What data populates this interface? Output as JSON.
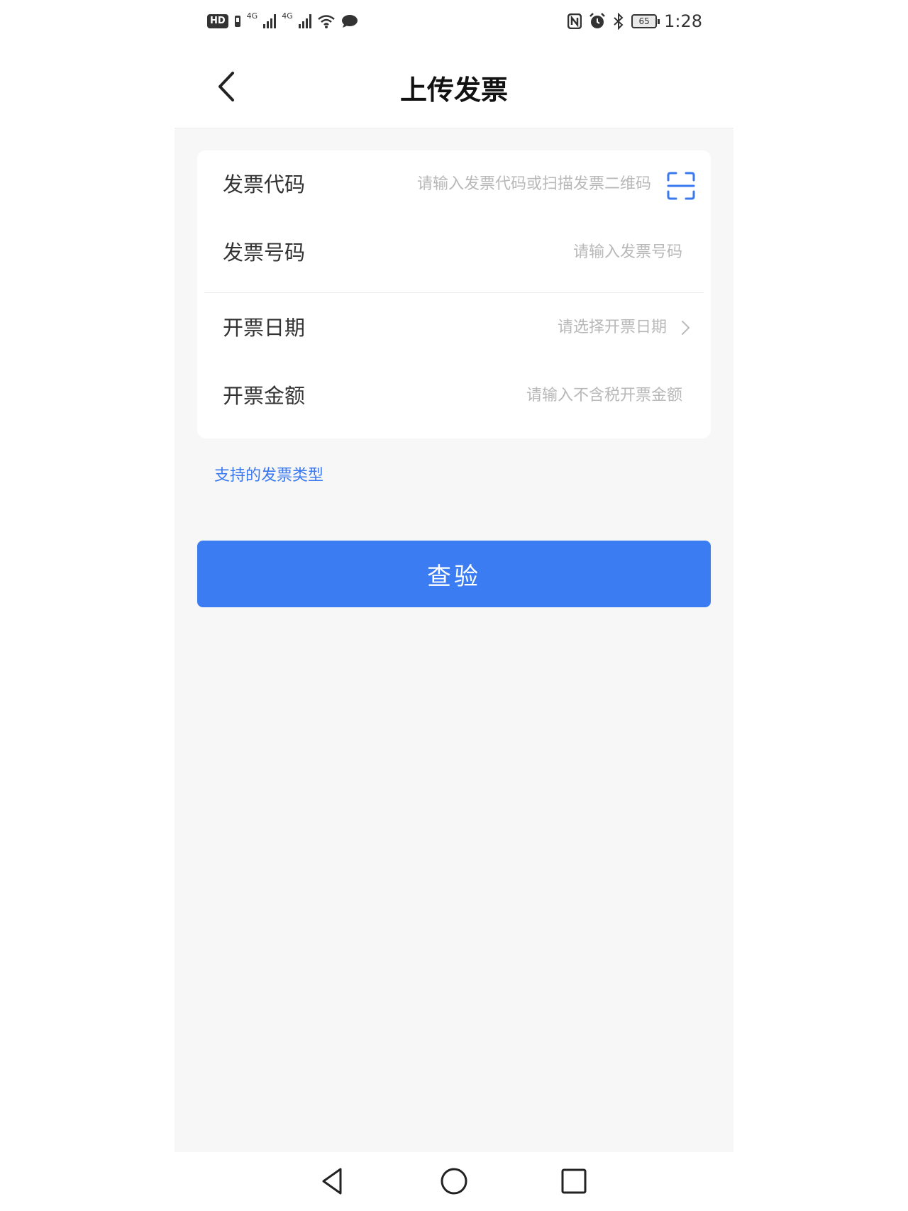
{
  "status_bar": {
    "hd_label": "HD",
    "net1": "4G",
    "net2": "4G",
    "battery": "65",
    "time": "1:28"
  },
  "header": {
    "title": "上传发票"
  },
  "form": {
    "fields": [
      {
        "label": "发票代码",
        "placeholder": "请输入发票代码或扫描发票二维码"
      },
      {
        "label": "发票号码",
        "placeholder": "请输入发票号码"
      },
      {
        "label": "开票日期",
        "placeholder": "请选择开票日期"
      },
      {
        "label": "开票金额",
        "placeholder": "请输入不含税开票金额"
      }
    ]
  },
  "links": {
    "supported_types": "支持的发票类型"
  },
  "actions": {
    "verify_label": "查验"
  },
  "colors": {
    "accent": "#3b7cf3",
    "link": "#3a78f0",
    "background": "#f7f7f7",
    "placeholder": "#b8b8b8"
  },
  "icons": {
    "back": "chevron-left-icon",
    "scan": "scan-qr-icon",
    "date_arrow": "chevron-right-icon",
    "nav_back": "triangle-back-icon",
    "nav_home": "circle-home-icon",
    "nav_recent": "square-recent-icon"
  }
}
